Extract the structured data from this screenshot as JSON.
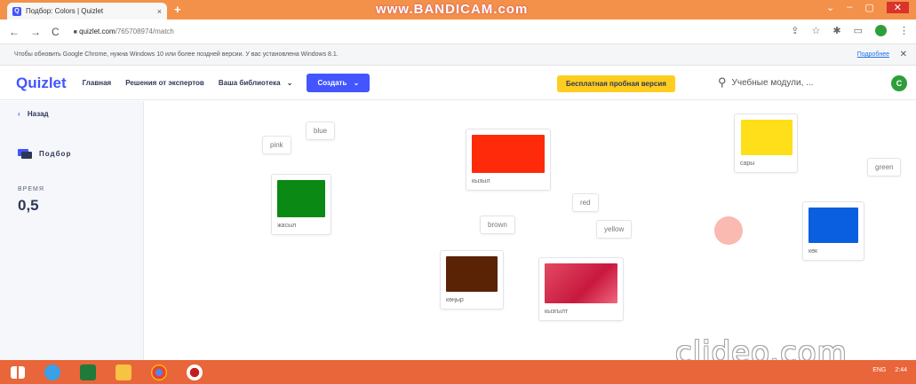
{
  "browser": {
    "tab_title": "Подбор: Colors | Quizlet",
    "tab_close": "×",
    "new_tab": "+",
    "watermark": "www.BANDICAM.com",
    "window_controls": [
      "⌄",
      "–",
      "▢",
      "✕"
    ],
    "nav_back": "←",
    "nav_forward": "→",
    "nav_reload": "C",
    "lock": "🔒",
    "url_host": "quizlet.com",
    "url_path": "/765708974/match",
    "notice_text": "Чтобы обновить Google Chrome, нужна Windows 10 или более поздней версии. У вас установлена Windows 8.1.",
    "notice_link": "Подробнее",
    "notice_close": "✕",
    "addr_icons": [
      "⇪",
      "☆",
      "✱",
      "▭"
    ],
    "addr_menu": "⋮"
  },
  "quizlet_nav": {
    "logo": "Quizlet",
    "links": [
      "Главная",
      "Решения от экспертов",
      "Ваша библиотека"
    ],
    "library_chevron": "⌄",
    "create_label": "Создать",
    "create_chevron": "⌄",
    "trial_label": "Бесплатная пробная версия",
    "search_icon": "⚲",
    "search_placeholder": "Учебные модули, ...",
    "avatar_letter": "C"
  },
  "sidebar": {
    "back_chevron": "‹",
    "back_label": "Назад",
    "mode_label": "Подбор",
    "time_label": "ВРЕМЯ",
    "time_value": "0,5"
  },
  "cards": {
    "blue_word": "blue",
    "pink_word": "pink",
    "green_word": "green",
    "red_word": "red",
    "brown_word": "brown",
    "yellow_word": "yellow",
    "img_red_caption": "кызыл",
    "img_yellow_caption": "сары",
    "img_green_caption": "жасыл",
    "img_blue_caption": "көк",
    "img_brown_caption": "көңыр",
    "img_pink_caption": "кызгылт"
  },
  "colors": {
    "red": "#ff2a0a",
    "yellow": "#ffdf1a",
    "green": "#0a8a14",
    "blue": "#0a5fe0",
    "brown": "#5a2305",
    "pink": "#d92b4f"
  },
  "overlay": {
    "clideo": "clideo.com"
  },
  "taskbar": {
    "icons": [
      "windows-start-icon",
      "ie-icon",
      "excel-icon",
      "file-explorer-icon",
      "chrome-icon",
      "recorder-icon"
    ],
    "lang": "ENG",
    "time": "2:44"
  }
}
